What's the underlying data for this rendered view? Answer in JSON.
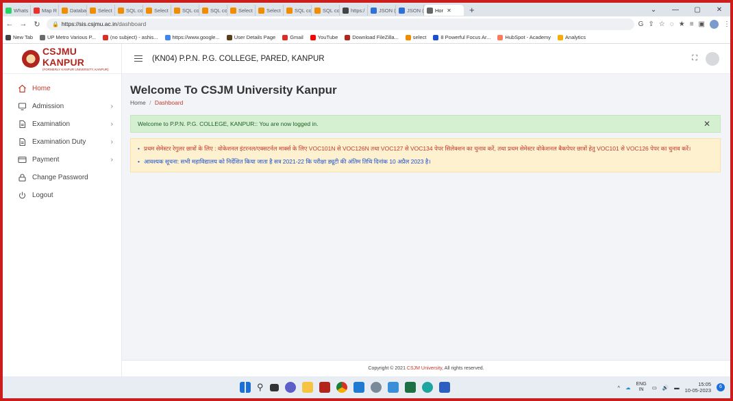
{
  "browser": {
    "tabs": [
      {
        "label": "Whats",
        "color": "#25d366"
      },
      {
        "label": "Map R",
        "color": "#e5322d"
      },
      {
        "label": "Databa",
        "color": "#f08c00"
      },
      {
        "label": "Select",
        "color": "#f08c00"
      },
      {
        "label": "SQL co",
        "color": "#f08c00"
      },
      {
        "label": "Select",
        "color": "#f08c00"
      },
      {
        "label": "SQL co",
        "color": "#f08c00"
      },
      {
        "label": "SQL co",
        "color": "#f08c00"
      },
      {
        "label": "Select",
        "color": "#f08c00"
      },
      {
        "label": "Select",
        "color": "#f08c00"
      },
      {
        "label": "SQL co",
        "color": "#f08c00"
      },
      {
        "label": "SQL co",
        "color": "#f08c00"
      },
      {
        "label": "https:/",
        "color": "#444444"
      },
      {
        "label": "JSON (",
        "color": "#2f6fd6"
      },
      {
        "label": "JSON (",
        "color": "#2f6fd6"
      },
      {
        "label": "Hor",
        "color": "#666666"
      }
    ],
    "url_host": "https://sis.csjmu.ac.in",
    "url_path": "/dashboard",
    "bookmarks": [
      {
        "label": "New Tab",
        "color": "#444444"
      },
      {
        "label": "UP Metro Various P...",
        "color": "#6a6a6a"
      },
      {
        "label": "(no subject) - ashis...",
        "color": "#d93025"
      },
      {
        "label": "https://www.google...",
        "color": "#4285f4"
      },
      {
        "label": "User Details Page",
        "color": "#5a3e1b"
      },
      {
        "label": "Gmail",
        "color": "#d93025"
      },
      {
        "label": "YouTube",
        "color": "#ff0000"
      },
      {
        "label": "Download FileZilla...",
        "color": "#b3261e"
      },
      {
        "label": "select",
        "color": "#f08c00"
      },
      {
        "label": "8 Powerful Focus Ar...",
        "color": "#1a4fd1"
      },
      {
        "label": "HubSpot - Academy",
        "color": "#ff7a59"
      },
      {
        "label": "Analytics",
        "color": "#f9ab00"
      }
    ]
  },
  "sidebar": {
    "logo_title": "CSJMU KANPUR",
    "logo_subtitle": "(FORMERLY KANPUR UNIVERSITY, KANPUR)",
    "items": [
      {
        "label": "Home",
        "icon": "home-icon",
        "has_chevron": false
      },
      {
        "label": "Admission",
        "icon": "monitor-icon",
        "has_chevron": true
      },
      {
        "label": "Examination",
        "icon": "document-icon",
        "has_chevron": true
      },
      {
        "label": "Examination Duty",
        "icon": "document-icon",
        "has_chevron": true
      },
      {
        "label": "Payment",
        "icon": "card-icon",
        "has_chevron": true
      },
      {
        "label": "Change Password",
        "icon": "lock-icon",
        "has_chevron": false
      },
      {
        "label": "Logout",
        "icon": "power-icon",
        "has_chevron": false
      }
    ]
  },
  "header": {
    "college": "(KN04) P.P.N. P.G. COLLEGE, PARED, KANPUR"
  },
  "main": {
    "title": "Welcome To CSJM University Kanpur",
    "breadcrumb_home": "Home",
    "breadcrumb_sep": "/",
    "breadcrumb_current": "Dashboard",
    "alert": "Welcome to P.P.N. P.G. COLLEGE, KANPUR:: You are now logged in.",
    "notices": [
      "प्रथम सेमेस्टर रेगुलर छात्रों के लिए : वोकेशनल इंटरनल/एक्सटर्नल मार्क्स के लिए VOC101N से VOC126N तथा VOC127 से VOC134 पेपर सिलेक्शन का चुनाव करें, तथा प्रथम सेमेस्टर वोकेशनल बैकपेपर छात्रों हेतु VOC101 से VOC126 पेपर का चुनाव करें।",
      "आवश्यक सूचना: सभी महाविद्यालय को निर्देशित किया जाता है सत्र 2021-22 कि परीक्षा ड्यूटी की अंतिम तिथि दिनांक 10 अप्रैल 2023 है।"
    ]
  },
  "footer": {
    "prefix": "Copyright © 2021 ",
    "link": "CSJM University",
    "suffix": ", All rights reserved."
  },
  "taskbar": {
    "lang_top": "ENG",
    "lang_bottom": "IN",
    "time": "15:05",
    "date": "10-05-2023",
    "notification_count": "6"
  },
  "colors": {
    "accent": "#c0392b",
    "success_bg": "#d5efd1",
    "warning_bg": "#fdf1cf",
    "notice_blue": "#1a4fd1"
  }
}
